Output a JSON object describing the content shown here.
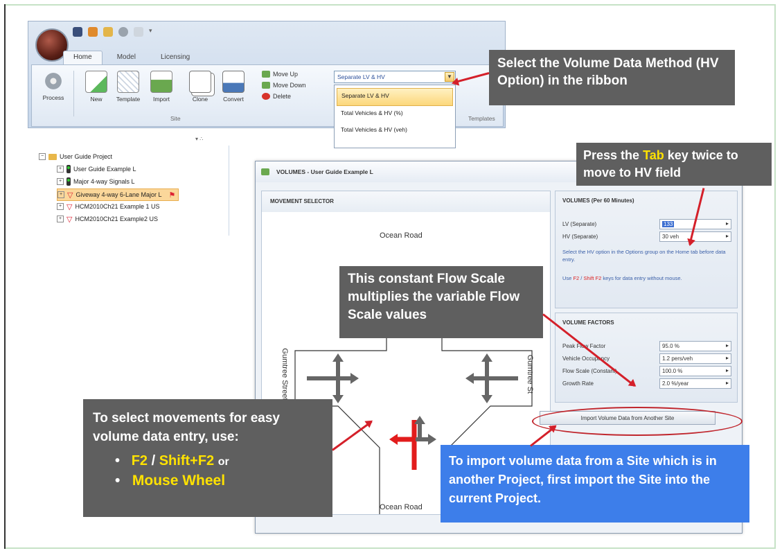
{
  "ribbon": {
    "tabs": [
      "Home",
      "Model",
      "Licensing"
    ],
    "buttons": {
      "process": "Process",
      "new": "New",
      "template": "Template",
      "import": "Import",
      "clone": "Clone",
      "convert": "Convert"
    },
    "small_commands": {
      "move_up": "Move Up",
      "move_down": "Move Down",
      "delete": "Delete"
    },
    "groups": {
      "site": "Site",
      "templates": "Templates"
    },
    "volume_method": {
      "selected": "Separate LV & HV",
      "options": [
        "Separate LV & HV",
        "Total Vehicles & HV (%)",
        "Total Vehicles & HV (veh)"
      ]
    }
  },
  "tree": {
    "items": [
      "User Guide Project",
      "User Guide Example L",
      "Major 4-way Signals L",
      "Giveway 4-way 6-Lane Major L",
      "HCM2010Ch21 Example 1 US",
      "HCM2010Ch21 Example2 US"
    ]
  },
  "dialog": {
    "title": "VOLUMES - User Guide Example L",
    "movement_selector": "MOVEMENT SELECTOR",
    "roads": {
      "top": "Ocean Road",
      "bottom": "Ocean Road",
      "left": "Gumtree Street",
      "right": "Gumtree St"
    },
    "volumes_head": "VOLUMES (Per 60 Minutes)",
    "lv_label": "LV (Separate)",
    "lv_value": "133",
    "hv_label": "HV (Separate)",
    "hv_value": "30 veh",
    "note1": "Select the HV option in the Options group on the Home tab before data entry.",
    "note2_pre": "Use",
    "note2_f2": "F2",
    "note2_sep": "/",
    "note2_shift": "Shift F2",
    "note2_post": "keys for data entry without mouse.",
    "factors_head": "VOLUME FACTORS",
    "factors": [
      {
        "label": "Peak Flow Factor",
        "value": "95.0 %"
      },
      {
        "label": "Vehicle Occupancy",
        "value": "1.2 pers/veh"
      },
      {
        "label": "Flow Scale (Constant)",
        "value": "100.0 %"
      },
      {
        "label": "Growth Rate",
        "value": "2.0 %/year"
      }
    ],
    "import_button": "Import Volume Data from Another Site"
  },
  "callouts": {
    "volume_method": "Select the Volume Data Method (HV Option) in the ribbon",
    "tab_pre": "Press the",
    "tab_key": "Tab",
    "tab_post": "key twice to move to HV field",
    "flow_scale": "This constant Flow Scale multiplies the variable Flow Scale values",
    "select_intro": "To select movements for easy volume data entry, use:",
    "f2": "F2",
    "slash": "/",
    "shift_f2": "Shift+F2",
    "or": "or",
    "mouse_wheel": "Mouse Wheel",
    "import_info": "To import volume data from a Site which is in another Project, first import the Site into the current Project."
  },
  "colors": {
    "callout_grey": "#5f5f5f",
    "callout_blue": "#3d7eea",
    "highlight_yellow": "#ffe200",
    "arrow_red": "#d4202a"
  }
}
